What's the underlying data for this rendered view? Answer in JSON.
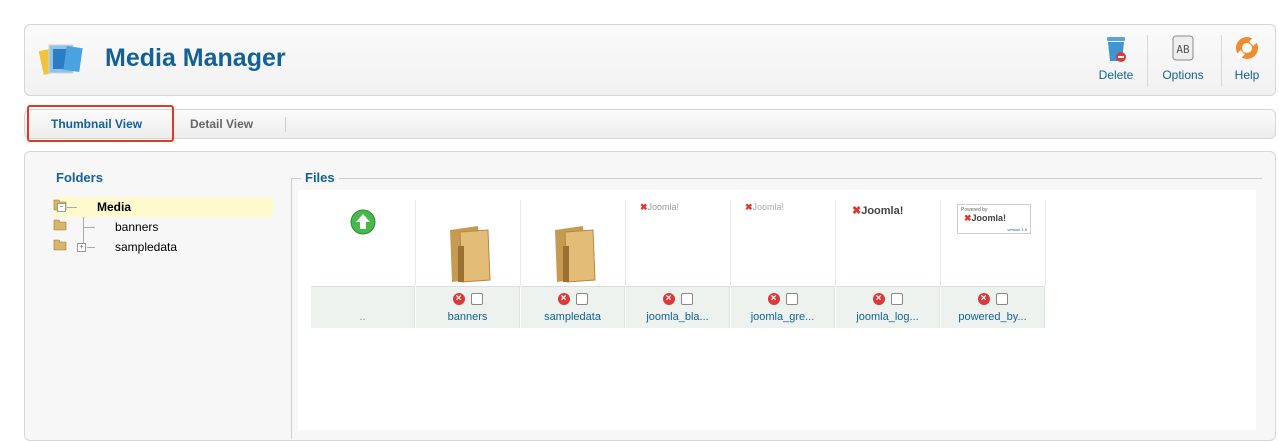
{
  "header": {
    "title": "Media Manager",
    "buttons": [
      {
        "label": "Delete",
        "icon": "trash-icon"
      },
      {
        "label": "Options",
        "icon": "options-icon"
      },
      {
        "label": "Help",
        "icon": "lifebuoy-icon"
      }
    ]
  },
  "tabs": [
    {
      "label": "Thumbnail View",
      "active": true
    },
    {
      "label": "Detail View",
      "active": false
    }
  ],
  "folders": {
    "title": "Folders",
    "tree": [
      {
        "label": "Media",
        "expanded": true,
        "selected": true
      },
      {
        "label": "banners"
      },
      {
        "label": "sampledata"
      }
    ]
  },
  "files": {
    "title": "Files",
    "items": [
      {
        "name": "..",
        "type": "up"
      },
      {
        "name": "banners",
        "type": "folder"
      },
      {
        "name": "sampledata",
        "type": "folder"
      },
      {
        "name": "joomla_bla...",
        "type": "image",
        "logo_text": "Joomla!"
      },
      {
        "name": "joomla_gre...",
        "type": "image",
        "logo_text": "Joomla!"
      },
      {
        "name": "joomla_log...",
        "type": "image",
        "logo_text": "Joomla!"
      },
      {
        "name": "powered_by...",
        "type": "image",
        "logo_text": "Joomla!",
        "caption": "Powered by",
        "version": "version 1.5"
      }
    ]
  },
  "colors": {
    "accent": "#146295",
    "highlight": "#e03a24"
  }
}
